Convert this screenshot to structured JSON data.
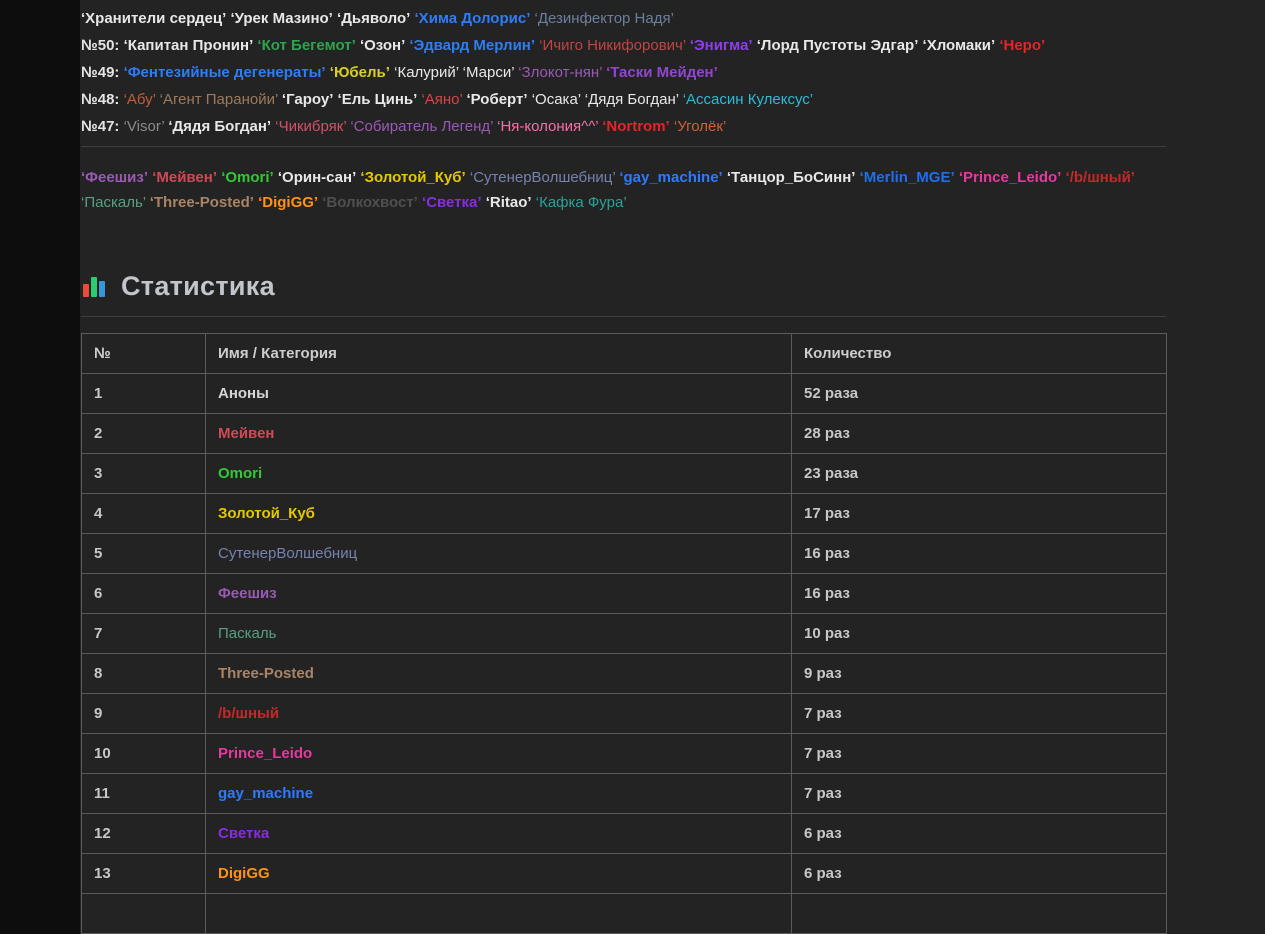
{
  "quote": {
    "open": "‘",
    "close": "’"
  },
  "top_lines": [
    {
      "label": "",
      "names": [
        {
          "text": "Хранители сердец",
          "color": "#e8e8e8",
          "bold": true
        },
        {
          "text": "Урек Мазино",
          "color": "#e8e8e8",
          "bold": true
        },
        {
          "text": "Дьяволо",
          "color": "#e8e8e8",
          "bold": true
        },
        {
          "text": "Хима Долорис",
          "color": "#2f7df6",
          "bold": true
        },
        {
          "text": "Дезинфектор Надя",
          "color": "#6b7f9e",
          "bold": false
        }
      ]
    },
    {
      "label": "№50:",
      "names": [
        {
          "text": "Капитан Пронин",
          "color": "#e8e8e8",
          "bold": true
        },
        {
          "text": "Кот Бегемот",
          "color": "#2da44e",
          "bold": true
        },
        {
          "text": "Озон",
          "color": "#e8e8e8",
          "bold": true
        },
        {
          "text": "Эдвард Мерлин",
          "color": "#2f7df6",
          "bold": true
        },
        {
          "text": "Ичиго Никифорович",
          "color": "#c24444",
          "bold": false
        },
        {
          "text": "Энигма",
          "color": "#8d3df0",
          "bold": true
        },
        {
          "text": "Лорд Пустоты Эдгар",
          "color": "#e8e8e8",
          "bold": true
        },
        {
          "text": "Хломаки",
          "color": "#e8e8e8",
          "bold": true
        },
        {
          "text": "Неро",
          "color": "#e3242b",
          "bold": true
        }
      ]
    },
    {
      "label": "№49:",
      "names": [
        {
          "text": "Фентезийные дегенераты",
          "color": "#2f7df6",
          "bold": true
        },
        {
          "text": "Юбель",
          "color": "#d9d020",
          "bold": true
        },
        {
          "text": "Калурий",
          "color": "#e8e8e8",
          "bold": false
        },
        {
          "text": "Марси",
          "color": "#e8e8e8",
          "bold": false
        },
        {
          "text": "Злокот-нян",
          "color": "#9b59b6",
          "bold": false
        },
        {
          "text": "Таски Мейден",
          "color": "#9146cf",
          "bold": true
        }
      ]
    },
    {
      "label": "№48:",
      "names": [
        {
          "text": "Абу",
          "color": "#c75b3e",
          "bold": false
        },
        {
          "text": "Агент Паранойи",
          "color": "#9c7a5a",
          "bold": false
        },
        {
          "text": "Гароу",
          "color": "#e8e8e8",
          "bold": true
        },
        {
          "text": "Ель Цинь",
          "color": "#e8e8e8",
          "bold": true
        },
        {
          "text": "Аяно",
          "color": "#d64545",
          "bold": false
        },
        {
          "text": "Роберт",
          "color": "#e8e8e8",
          "bold": true
        },
        {
          "text": "Осака",
          "color": "#e8e8e8",
          "bold": false
        },
        {
          "text": "Дядя Богдан",
          "color": "#e8e8e8",
          "bold": false
        },
        {
          "text": "Ассасин Кулексус",
          "color": "#2bbbd8",
          "bold": false
        }
      ]
    },
    {
      "label": "№47:",
      "names": [
        {
          "text": "Visor",
          "color": "#8b8b8b",
          "bold": false
        },
        {
          "text": "Дядя Богдан",
          "color": "#e8e8e8",
          "bold": true
        },
        {
          "text": "Чикибряк",
          "color": "#d1506a",
          "bold": false
        },
        {
          "text": "Собиратель Легенд",
          "color": "#9b59b6",
          "bold": false
        },
        {
          "text": "Ня-колония^^",
          "color": "#ff6ba8",
          "bold": false
        },
        {
          "text": "Nortrom",
          "color": "#e3242b",
          "bold": true
        },
        {
          "text": "Уголёк",
          "color": "#d2603a",
          "bold": false
        }
      ]
    }
  ],
  "mentions": [
    {
      "text": "Феешиз",
      "color": "#9b59b6",
      "bold": true
    },
    {
      "text": "Мейвен",
      "color": "#cf4a55",
      "bold": true
    },
    {
      "text": "Omori",
      "color": "#31c936",
      "bold": true
    },
    {
      "text": "Орин-сан",
      "color": "#e8e8e8",
      "bold": true
    },
    {
      "text": "Золотой_Куб",
      "color": "#e3c800",
      "bold": true
    },
    {
      "text": "СутенерВолшебниц",
      "color": "#7583b0",
      "bold": false
    },
    {
      "text": "gay_machine",
      "color": "#2b7bff",
      "bold": true
    },
    {
      "text": "Танцор_БоСинн",
      "color": "#e8e8e8",
      "bold": true
    },
    {
      "text": "Merlin_MGE",
      "color": "#1f6feb",
      "bold": true
    },
    {
      "text": "Prince_Leido",
      "color": "#e5399e",
      "bold": true
    },
    {
      "text": "/b/шный",
      "color": "#c62828",
      "bold": true
    },
    {
      "text": "Паскаль",
      "color": "#58a083",
      "bold": false
    },
    {
      "text": "Three-Posted",
      "color": "#a98467",
      "bold": true
    },
    {
      "text": "DigiGG",
      "color": "#ff9214",
      "bold": true
    },
    {
      "text": "Волкохвост",
      "color": "#4f4f4f",
      "bold": true
    },
    {
      "text": "Светка",
      "color": "#8a2be2",
      "bold": true
    },
    {
      "text": "Ritao",
      "color": "#e8e8e8",
      "bold": true
    },
    {
      "text": "Кафка Фура",
      "color": "#2aa198",
      "bold": false
    }
  ],
  "stats": {
    "heading": "Статистика",
    "icon": "bar-chart",
    "icon_colors": {
      "red": "#e74c3c",
      "green": "#2ecc71",
      "blue": "#3498db"
    },
    "table": {
      "headers": [
        "№",
        "Имя / Категория",
        "Количество"
      ],
      "rows": [
        {
          "num": "1",
          "name": "Аноны",
          "color": "#d6d6d6",
          "bold": true,
          "count": "52 раза"
        },
        {
          "num": "2",
          "name": "Мейвен",
          "color": "#cf4a55",
          "bold": true,
          "count": "28 раз"
        },
        {
          "num": "3",
          "name": "Omori",
          "color": "#31c936",
          "bold": true,
          "count": "23 раза"
        },
        {
          "num": "4",
          "name": "Золотой_Куб",
          "color": "#e3c800",
          "bold": true,
          "count": "17 раз"
        },
        {
          "num": "5",
          "name": "СутенерВолшебниц",
          "color": "#7583b0",
          "bold": false,
          "count": "16 раз"
        },
        {
          "num": "6",
          "name": "Феешиз",
          "color": "#9b59b6",
          "bold": true,
          "count": "16 раз"
        },
        {
          "num": "7",
          "name": "Паскаль",
          "color": "#58a083",
          "bold": false,
          "count": "10 раз"
        },
        {
          "num": "8",
          "name": "Three-Posted",
          "color": "#a98467",
          "bold": true,
          "count": "9 раз"
        },
        {
          "num": "9",
          "name": "/b/шный",
          "color": "#c62828",
          "bold": true,
          "count": "7 раз"
        },
        {
          "num": "10",
          "name": "Prince_Leido",
          "color": "#e5399e",
          "bold": true,
          "count": "7 раз"
        },
        {
          "num": "11",
          "name": "gay_machine",
          "color": "#2b7bff",
          "bold": true,
          "count": "7 раз"
        },
        {
          "num": "12",
          "name": "Светка",
          "color": "#8a2be2",
          "bold": true,
          "count": "6 раз"
        },
        {
          "num": "13",
          "name": "DigiGG",
          "color": "#ff9214",
          "bold": true,
          "count": "6 раз"
        }
      ]
    }
  }
}
